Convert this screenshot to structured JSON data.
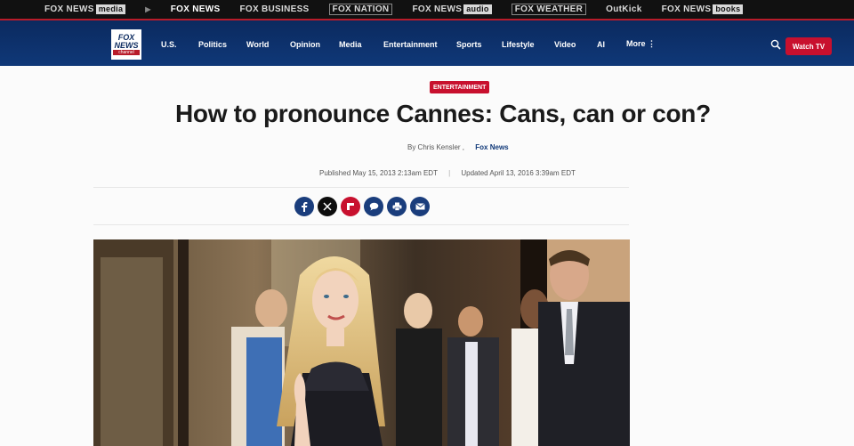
{
  "brandbar": {
    "items": [
      "FOX NEWS",
      "media",
      "FOX NEWS",
      "FOX BUSINESS",
      "FOX NATION",
      "FOX NEWS",
      "audio",
      "FOX WEATHER",
      "OutKick",
      "FOX NEWS",
      "books"
    ]
  },
  "nav": {
    "logo": [
      "FOX",
      "NEWS",
      "channel"
    ],
    "items": [
      "U.S.",
      "Politics",
      "World",
      "Opinion",
      "Media",
      "Entertainment",
      "Sports",
      "Lifestyle",
      "Video",
      "AI",
      "More ⋮"
    ],
    "watch_label": "Watch TV"
  },
  "article": {
    "tag": "ENTERTAINMENT",
    "title": "How to pronounce Cannes: Cans, can or con?",
    "byline_prefix": "By Chris Kensler ,",
    "byline_source": "Fox News",
    "published": "Published May 15, 2013 2:13am EDT",
    "separator": "|",
    "updated": "Updated April 13, 2016 3:39am EDT"
  },
  "share": {
    "icons": [
      "facebook-icon",
      "x-icon",
      "flipboard-icon",
      "comment-icon",
      "print-icon",
      "email-icon"
    ]
  },
  "colors": {
    "nav_bg": "#0f3878",
    "accent": "#c8102e",
    "brandbar_bg": "#111111"
  }
}
